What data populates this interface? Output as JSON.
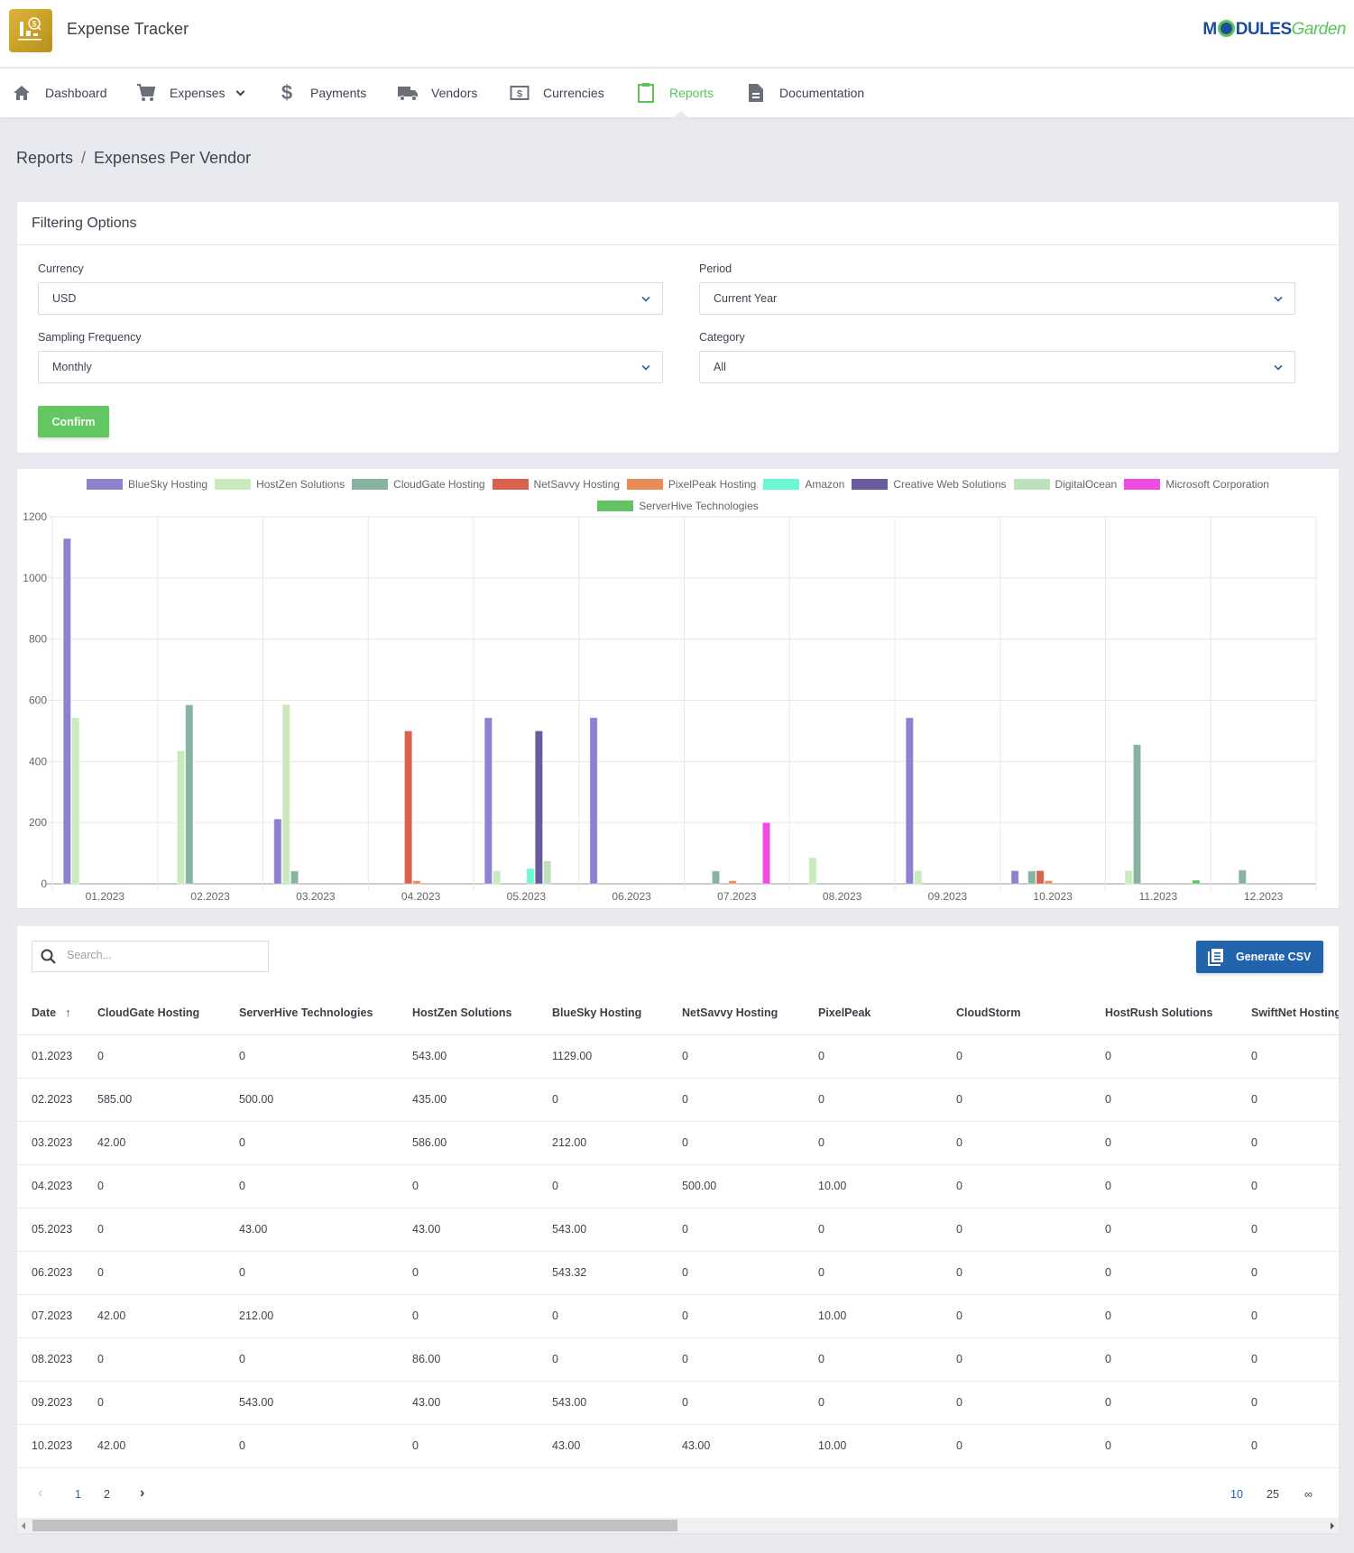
{
  "app": {
    "title": "Expense Tracker",
    "brand_left": "M",
    "brand_mid": "DULES",
    "brand_right": "Garden"
  },
  "nav": [
    {
      "label": "Dashboard",
      "icon": "home-icon"
    },
    {
      "label": "Expenses",
      "icon": "cart-icon",
      "has_dropdown": true
    },
    {
      "label": "Payments",
      "icon": "dollar-icon"
    },
    {
      "label": "Vendors",
      "icon": "truck-icon"
    },
    {
      "label": "Currencies",
      "icon": "currency-icon"
    },
    {
      "label": "Reports",
      "icon": "clipboard-icon",
      "active": true
    },
    {
      "label": "Documentation",
      "icon": "document-icon"
    }
  ],
  "breadcrumb": {
    "parent": "Reports",
    "separator": "/",
    "current": "Expenses Per Vendor"
  },
  "filters": {
    "title": "Filtering Options",
    "currency": {
      "label": "Currency",
      "value": "USD"
    },
    "period": {
      "label": "Period",
      "value": "Current Year"
    },
    "sampling": {
      "label": "Sampling Frequency",
      "value": "Monthly"
    },
    "category": {
      "label": "Category",
      "value": "All"
    },
    "confirm_label": "Confirm"
  },
  "chart_data": {
    "type": "bar",
    "title": "",
    "xlabel": "",
    "ylabel": "",
    "ylim": [
      0,
      1200
    ],
    "yticks": [
      0,
      200,
      400,
      600,
      800,
      1000,
      1200
    ],
    "grid": true,
    "legend_position": "top",
    "categories": [
      "01.2023",
      "02.2023",
      "03.2023",
      "04.2023",
      "05.2023",
      "06.2023",
      "07.2023",
      "08.2023",
      "09.2023",
      "10.2023",
      "11.2023",
      "12.2023"
    ],
    "series": [
      {
        "name": "BlueSky Hosting",
        "color": "#8e82d0",
        "values": [
          1129,
          0,
          212,
          0,
          543,
          543.32,
          0,
          0,
          543,
          43,
          0,
          0
        ]
      },
      {
        "name": "HostZen Solutions",
        "color": "#c9eabd",
        "values": [
          543,
          435,
          586,
          0,
          43,
          0,
          0,
          86,
          43,
          0,
          43,
          0
        ]
      },
      {
        "name": "CloudGate Hosting",
        "color": "#86b4a0",
        "values": [
          0,
          585,
          42,
          0,
          0,
          0,
          42,
          0,
          0,
          42,
          455,
          45
        ]
      },
      {
        "name": "NetSavvy Hosting",
        "color": "#db604d",
        "values": [
          0,
          0,
          0,
          500,
          0,
          0,
          0,
          0,
          0,
          43,
          0,
          0
        ]
      },
      {
        "name": "PixelPeak Hosting",
        "color": "#ec8b5a",
        "values": [
          0,
          0,
          0,
          10,
          0,
          0,
          10,
          0,
          0,
          10,
          0,
          0
        ]
      },
      {
        "name": "Amazon",
        "color": "#6cf8d2",
        "values": [
          0,
          0,
          0,
          0,
          50,
          0,
          0,
          0,
          0,
          0,
          0,
          0
        ]
      },
      {
        "name": "Creative Web Solutions",
        "color": "#6a5a9e",
        "values": [
          0,
          0,
          0,
          0,
          500,
          0,
          0,
          0,
          0,
          0,
          0,
          0
        ]
      },
      {
        "name": "DigitalOcean",
        "color": "#bde0bf",
        "values": [
          0,
          0,
          0,
          0,
          75,
          0,
          0,
          0,
          0,
          0,
          0,
          0
        ]
      },
      {
        "name": "Microsoft Corporation",
        "color": "#f04be0",
        "values": [
          0,
          0,
          0,
          0,
          0,
          0,
          200,
          0,
          0,
          0,
          0,
          0
        ]
      },
      {
        "name": "ServerHive Technologies",
        "color": "#63c262",
        "values": [
          0,
          0,
          0,
          0,
          0,
          0,
          0,
          0,
          0,
          0,
          12,
          0
        ]
      }
    ]
  },
  "table": {
    "search_placeholder": "Search...",
    "search_value": "",
    "csv_label": "Generate CSV",
    "sort_indicator": "↑",
    "columns": [
      "Date",
      "CloudGate Hosting",
      "ServerHive Technologies",
      "HostZen Solutions",
      "BlueSky Hosting",
      "NetSavvy Hosting",
      "PixelPeak",
      "CloudStorm",
      "HostRush Solutions",
      "SwiftNet Hosting"
    ],
    "rows": [
      [
        "01.2023",
        "0",
        "0",
        "543.00",
        "1129.00",
        "0",
        "0",
        "0",
        "0",
        "0"
      ],
      [
        "02.2023",
        "585.00",
        "500.00",
        "435.00",
        "0",
        "0",
        "0",
        "0",
        "0",
        "0"
      ],
      [
        "03.2023",
        "42.00",
        "0",
        "586.00",
        "212.00",
        "0",
        "0",
        "0",
        "0",
        "0"
      ],
      [
        "04.2023",
        "0",
        "0",
        "0",
        "0",
        "500.00",
        "10.00",
        "0",
        "0",
        "0"
      ],
      [
        "05.2023",
        "0",
        "43.00",
        "43.00",
        "543.00",
        "0",
        "0",
        "0",
        "0",
        "0"
      ],
      [
        "06.2023",
        "0",
        "0",
        "0",
        "543.32",
        "0",
        "0",
        "0",
        "0",
        "0"
      ],
      [
        "07.2023",
        "42.00",
        "212.00",
        "0",
        "0",
        "0",
        "10.00",
        "0",
        "0",
        "0"
      ],
      [
        "08.2023",
        "0",
        "0",
        "86.00",
        "0",
        "0",
        "0",
        "0",
        "0",
        "0"
      ],
      [
        "09.2023",
        "0",
        "543.00",
        "43.00",
        "543.00",
        "0",
        "0",
        "0",
        "0",
        "0"
      ],
      [
        "10.2023",
        "42.00",
        "0",
        "0",
        "43.00",
        "43.00",
        "10.00",
        "0",
        "0",
        "0"
      ]
    ],
    "pagination": {
      "pages": [
        "1",
        "2"
      ],
      "current_page": "1",
      "per_page_options": [
        "10",
        "25",
        "∞"
      ],
      "per_page_selected": "10"
    }
  }
}
